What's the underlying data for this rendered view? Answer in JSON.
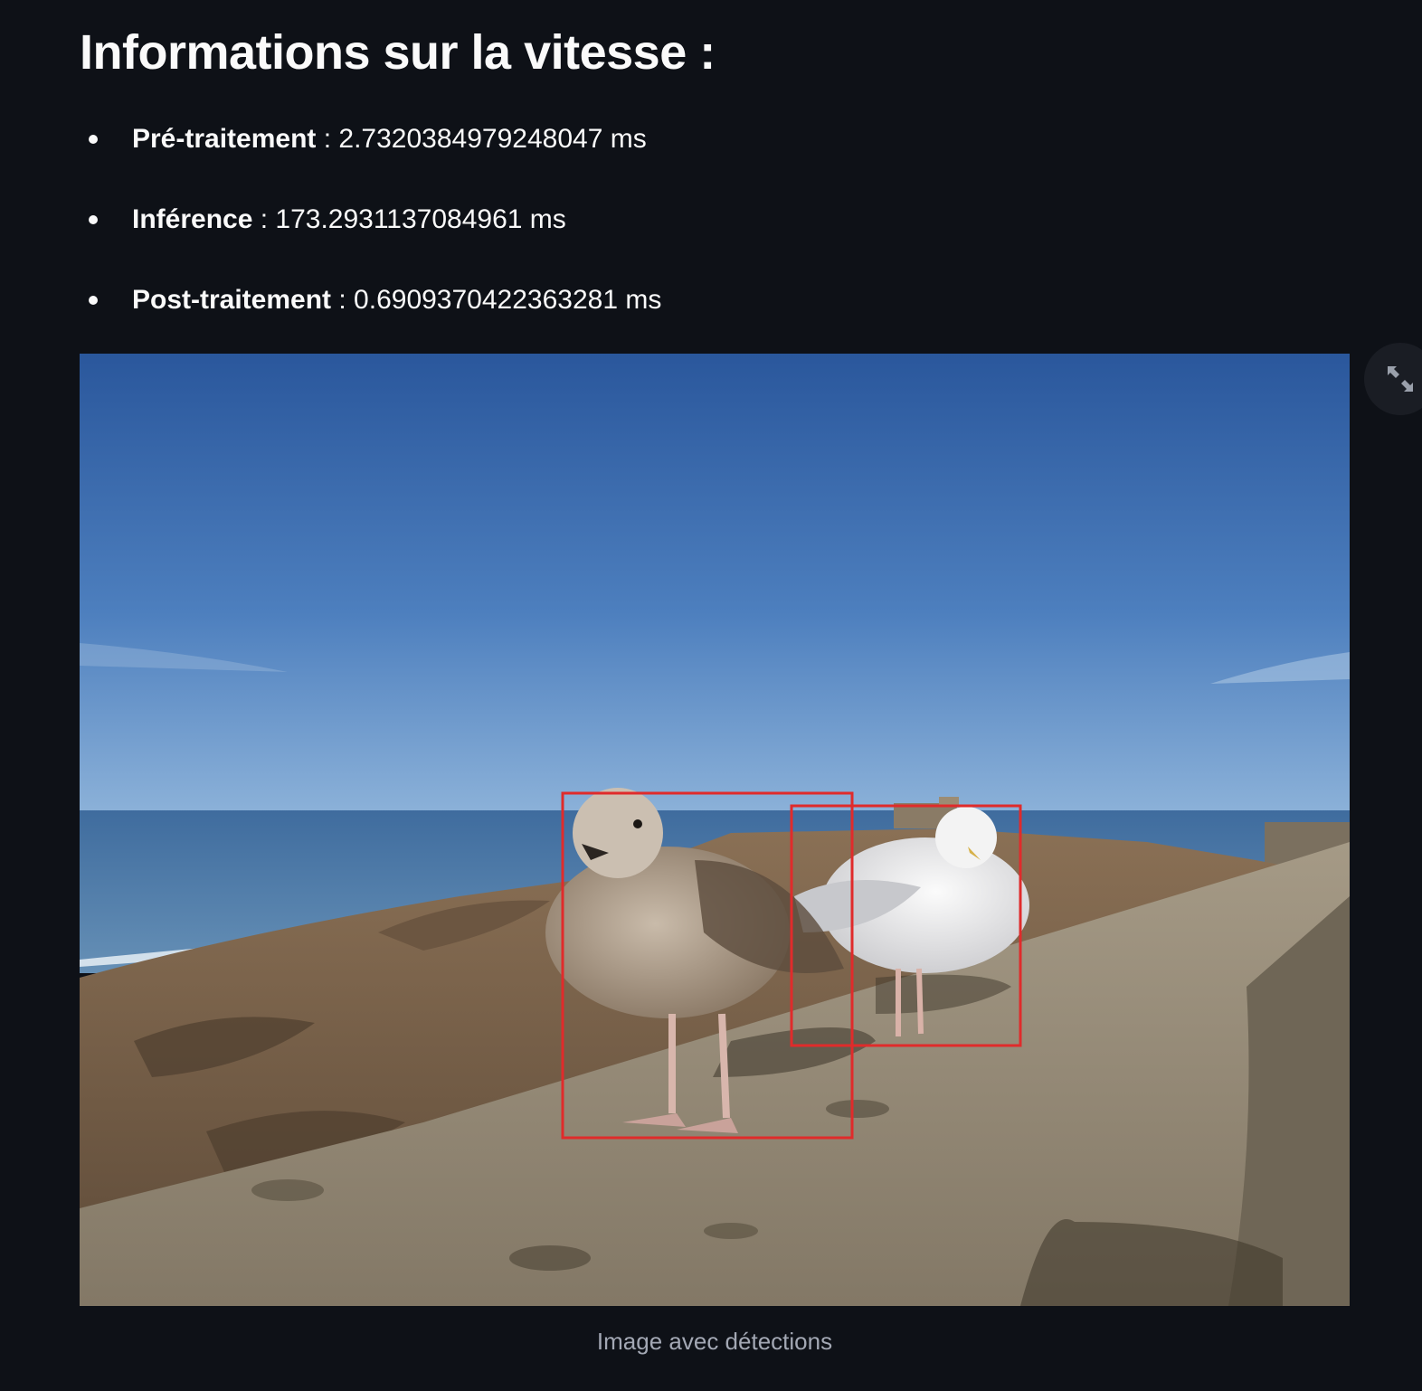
{
  "heading": "Informations sur la vitesse :",
  "speed_items": [
    {
      "key": "Pré-traitement",
      "value": " : 2.7320384979248047 ms"
    },
    {
      "key": "Inférence",
      "value": " : 173.2931137084961 ms"
    },
    {
      "key": "Post-traitement",
      "value": " : 0.6909370422363281 ms"
    }
  ],
  "image": {
    "caption": "Image avec détections",
    "subject": "two seagulls on a stone sea wall with detection boxes",
    "box_color": "#e02b2b"
  },
  "fullscreen_button": {
    "icon": "expand-arrows-icon"
  },
  "colors": {
    "background": "#0e1117",
    "text": "#fafafa",
    "caption": "#a3a8b4"
  }
}
